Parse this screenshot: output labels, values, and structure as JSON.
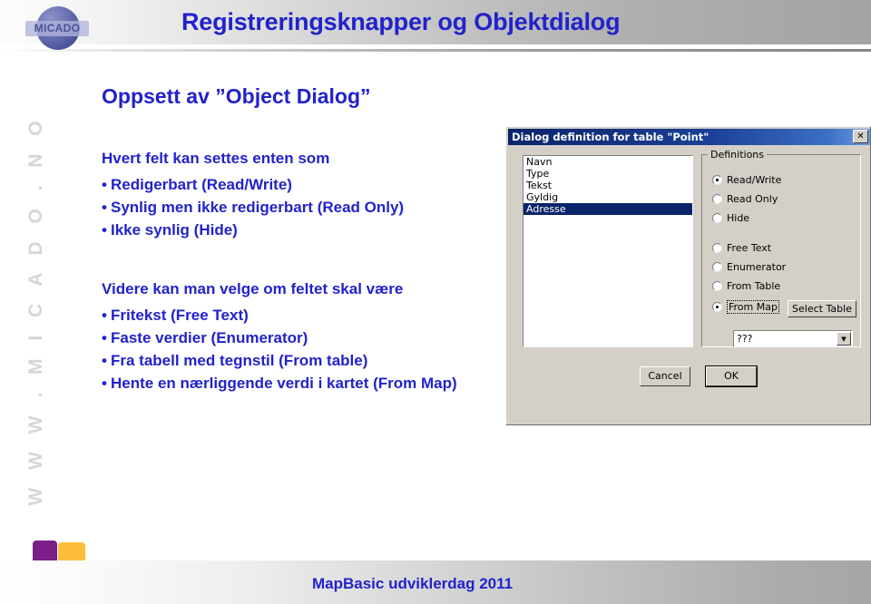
{
  "slide": {
    "header_title": "Registreringsknapper og Objektdialog",
    "subtitle": "Oppsett av ”Object Dialog”",
    "footer_text": "MapBasic udviklerdag 2011",
    "side_url": "W W W . M I C A D O . N O",
    "logo_text": "MICADO"
  },
  "content": {
    "lead_1": "Hvert felt kan settes enten som",
    "bullets_1": [
      "Redigerbart (Read/Write)",
      "Synlig men ikke redigerbart (Read Only)",
      "Ikke synlig  (Hide)"
    ],
    "lead_2": "Videre kan man velge om feltet skal være",
    "bullets_2": [
      "Fritekst (Free Text)",
      "Faste verdier (Enumerator)",
      "Fra tabell med tegnstil (From table)",
      "Hente en nærliggende verdi i kartet (From Map)"
    ]
  },
  "dialog": {
    "title": "Dialog definition for table \"Point\"",
    "close_label": "✕",
    "field_list": [
      {
        "label": "Navn",
        "selected": false
      },
      {
        "label": "Type",
        "selected": false
      },
      {
        "label": "Tekst",
        "selected": false
      },
      {
        "label": "Gyldig",
        "selected": false
      },
      {
        "label": "Adresse",
        "selected": true
      }
    ],
    "group_legend": "Definitions",
    "access_options": [
      {
        "label": "Read/Write",
        "selected": true
      },
      {
        "label": "Read Only",
        "selected": false
      },
      {
        "label": "Hide",
        "selected": false
      }
    ],
    "source_options": [
      {
        "label": "Free Text",
        "selected": false
      },
      {
        "label": "Enumerator",
        "selected": false
      },
      {
        "label": "From Table",
        "selected": false
      },
      {
        "label": "From Map",
        "selected": true
      }
    ],
    "select_table_label": "Select Table",
    "combo_value": "???",
    "combo_arrow": "▼",
    "cancel_label": "Cancel",
    "ok_label": "OK"
  },
  "colors": {
    "accent_blue": "#2222cc",
    "titlebar_blue": "#0a246a",
    "dialog_face": "#d4d0c8",
    "square_purple": "#7b1f86",
    "square_yellow": "#fcbd3a",
    "square_orange": "#f19a2b",
    "square_teal": "#5fc2b0"
  }
}
